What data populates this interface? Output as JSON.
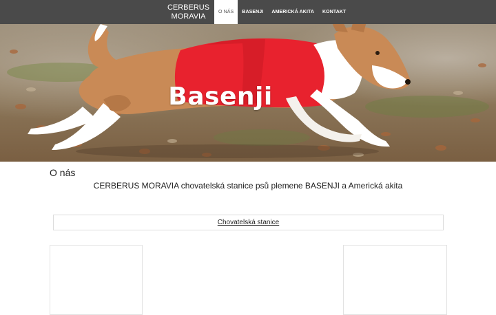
{
  "brand": {
    "line1": "CERBERUS",
    "line2": "MORAVIA"
  },
  "nav": {
    "items": [
      {
        "label": "O nás",
        "active": true
      },
      {
        "label": "BASENJI",
        "active": false
      },
      {
        "label": "AMERICKÁ AKITA",
        "active": false
      },
      {
        "label": "KONTAKT",
        "active": false
      }
    ]
  },
  "hero": {
    "title": "Basenji"
  },
  "content": {
    "section_title": "O nás",
    "lead": "CERBERUS MORAVIA  chovatelská stanice psů plemene BASENJI a Americká akita",
    "link_label": "Chovatelská stanice"
  },
  "colors": {
    "nav_bg": "#4a4a4a",
    "nav_text": "#ffffff",
    "active_bg": "#ffffff",
    "vest": "#e8222e"
  }
}
